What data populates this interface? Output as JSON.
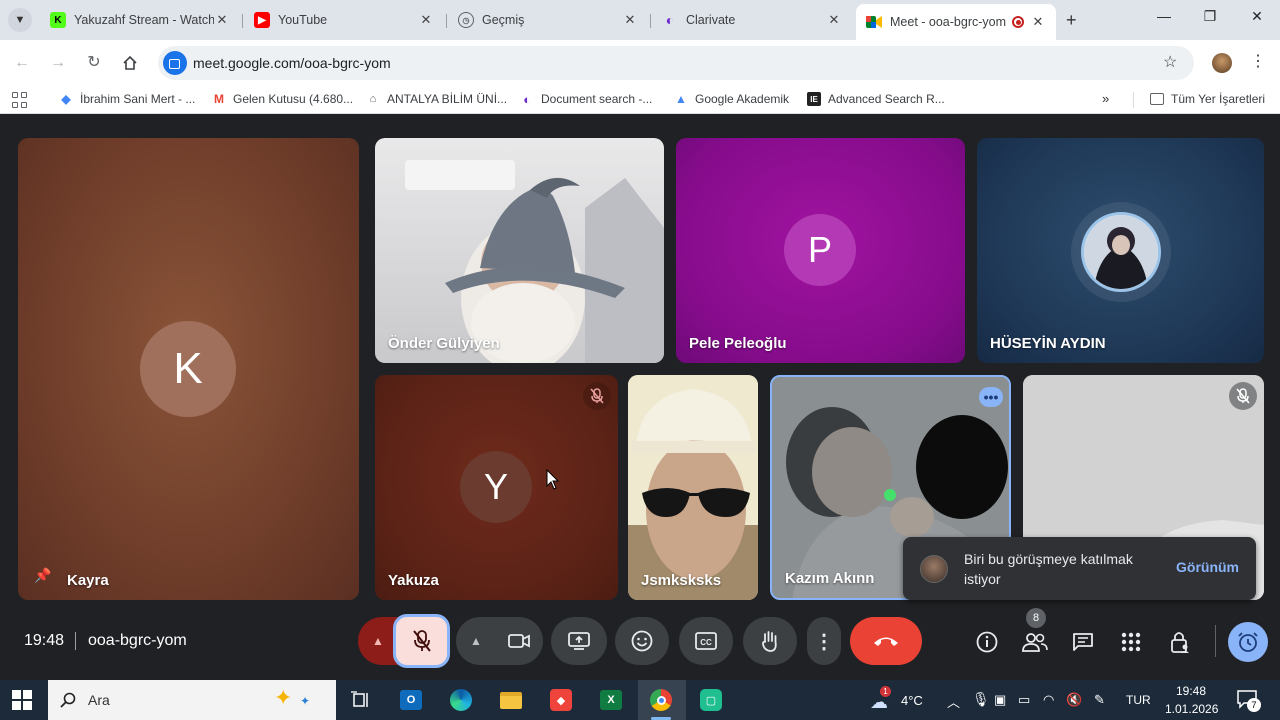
{
  "browser": {
    "tabs": [
      {
        "title": "Yakuzahf Stream - Watch",
        "icon": "kick-icon",
        "color": "#53fc18"
      },
      {
        "title": "YouTube",
        "icon": "youtube-icon",
        "color": "#ff0000"
      },
      {
        "title": "Geçmiş",
        "icon": "history-icon",
        "color": "#5f6368"
      },
      {
        "title": "Clarivate",
        "icon": "clarivate-icon",
        "color": "#6e2ccf"
      },
      {
        "title": "Meet - ooa-bgrc-yom",
        "icon": "meet-icon",
        "color": "#00897b",
        "active": true
      }
    ],
    "url": "meet.google.com/ooa-bgrc-yom",
    "bookmarks": [
      {
        "label": "İbrahim Sani Mert - ...",
        "icon": "drive-icon",
        "color": "#4285f4"
      },
      {
        "label": "Gelen Kutusu (4.680...",
        "icon": "gmail-icon",
        "color": "#ea4335"
      },
      {
        "label": "ANTALYA BİLİM ÜNİ...",
        "icon": "university-icon",
        "color": "#5f6368"
      },
      {
        "label": "Document search -...",
        "icon": "clarivate-icon",
        "color": "#6e2ccf"
      },
      {
        "label": "Google Akademik",
        "icon": "scholar-icon",
        "color": "#4285f4"
      },
      {
        "label": "Advanced Search R...",
        "icon": "ieee-icon",
        "color": "#222222"
      }
    ],
    "all_bookmarks": "Tüm Yer İşaretleri"
  },
  "meet": {
    "participants": [
      {
        "name": "Kayra",
        "initial": "K",
        "pinned": true
      },
      {
        "name": "Önder Gülyiyen",
        "video": true
      },
      {
        "name": "Pele Peleoğlu",
        "initial": "P"
      },
      {
        "name": "HÜSEYİN AYDIN",
        "avatar": true
      },
      {
        "name": "Yakuza",
        "initial": "Y",
        "muted": true
      },
      {
        "name": "Jsmksksks",
        "video": true
      },
      {
        "name": "Kazım Akınn",
        "video": true,
        "speaking": true
      },
      {
        "name": "",
        "video": true,
        "muted": true
      }
    ],
    "time": "19:48",
    "meeting_code": "ooa-bgrc-yom",
    "people_count": "8",
    "toast": {
      "message": "Biri bu görüşmeye katılmak istiyor",
      "action": "Görünüm"
    },
    "colors": {
      "end_call": "#ea4335",
      "accent": "#8ab4f8",
      "mic_off_bg": "#f9dedc"
    }
  },
  "taskbar": {
    "search_placeholder": "Ara",
    "weather": "4°C",
    "weather_badge": "1",
    "language": "TUR",
    "clock_time": "19:48",
    "clock_date": "1.01.2026",
    "notification_count": "7"
  }
}
